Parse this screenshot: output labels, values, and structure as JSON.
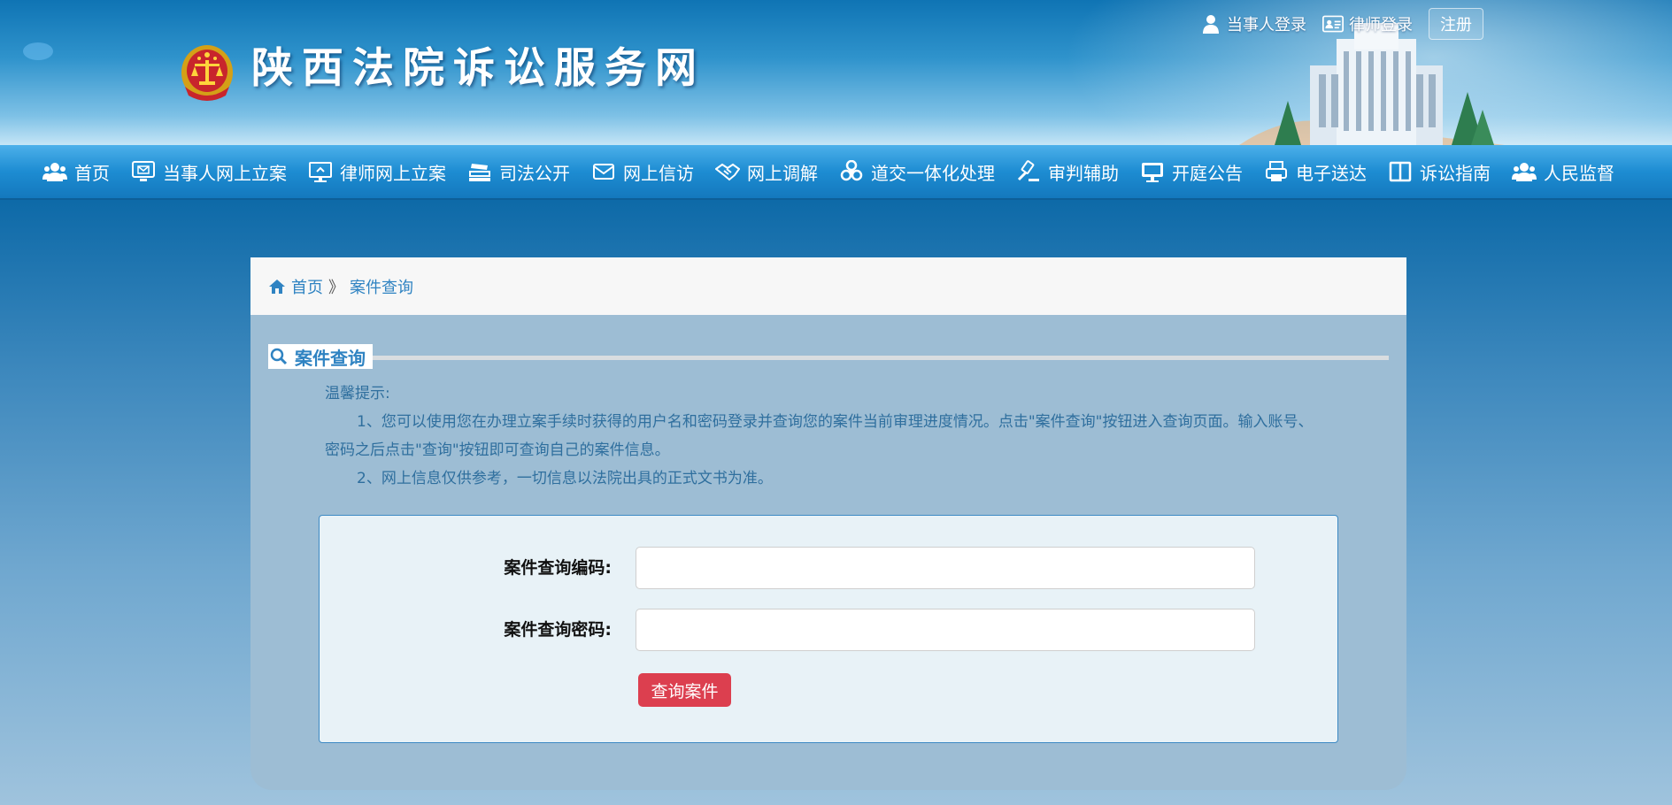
{
  "header": {
    "site_title": "陕西法院诉讼服务网",
    "top_links": {
      "party_login": "当事人登录",
      "lawyer_login": "律师登录",
      "register": "注册"
    }
  },
  "nav": {
    "items": [
      {
        "label": "首页",
        "icon": "people-icon"
      },
      {
        "label": "当事人网上立案",
        "icon": "monitor-icon"
      },
      {
        "label": "律师网上立案",
        "icon": "desktop-icon"
      },
      {
        "label": "司法公开",
        "icon": "books-icon"
      },
      {
        "label": "网上信访",
        "icon": "mail-icon"
      },
      {
        "label": "网上调解",
        "icon": "handshake-icon"
      },
      {
        "label": "道交一体化处理",
        "icon": "biohazard-icon"
      },
      {
        "label": "审判辅助",
        "icon": "gavel-icon"
      },
      {
        "label": "开庭公告",
        "icon": "screen-icon"
      },
      {
        "label": "电子送达",
        "icon": "printer-icon"
      },
      {
        "label": "诉讼指南",
        "icon": "book-icon"
      },
      {
        "label": "人民监督",
        "icon": "people-icon"
      }
    ]
  },
  "breadcrumb": {
    "home": "首页",
    "separator": "》",
    "current": "案件查询"
  },
  "section": {
    "title": "案件查询"
  },
  "notice": {
    "heading": "温馨提示:",
    "line1": "1、您可以使用您在办理立案手续时获得的用户名和密码登录并查询您的案件当前审理进度情况。点击\"案件查询\"按钮进入查询页面。输入账号、密码之后点击\"查询\"按钮即可查询自己的案件信息。",
    "line2": "2、网上信息仅供参考，一切信息以法院出具的正式文书为准。"
  },
  "form": {
    "code_label": "案件查询编码:",
    "code_value": "",
    "password_label": "案件查询密码:",
    "password_value": "",
    "submit_label": "查询案件"
  },
  "colors": {
    "nav_bar": "#1d8cd2",
    "link_blue": "#2f83c2",
    "submit_red": "#dc3f4f",
    "panel_bg": "#9dbdd4"
  }
}
